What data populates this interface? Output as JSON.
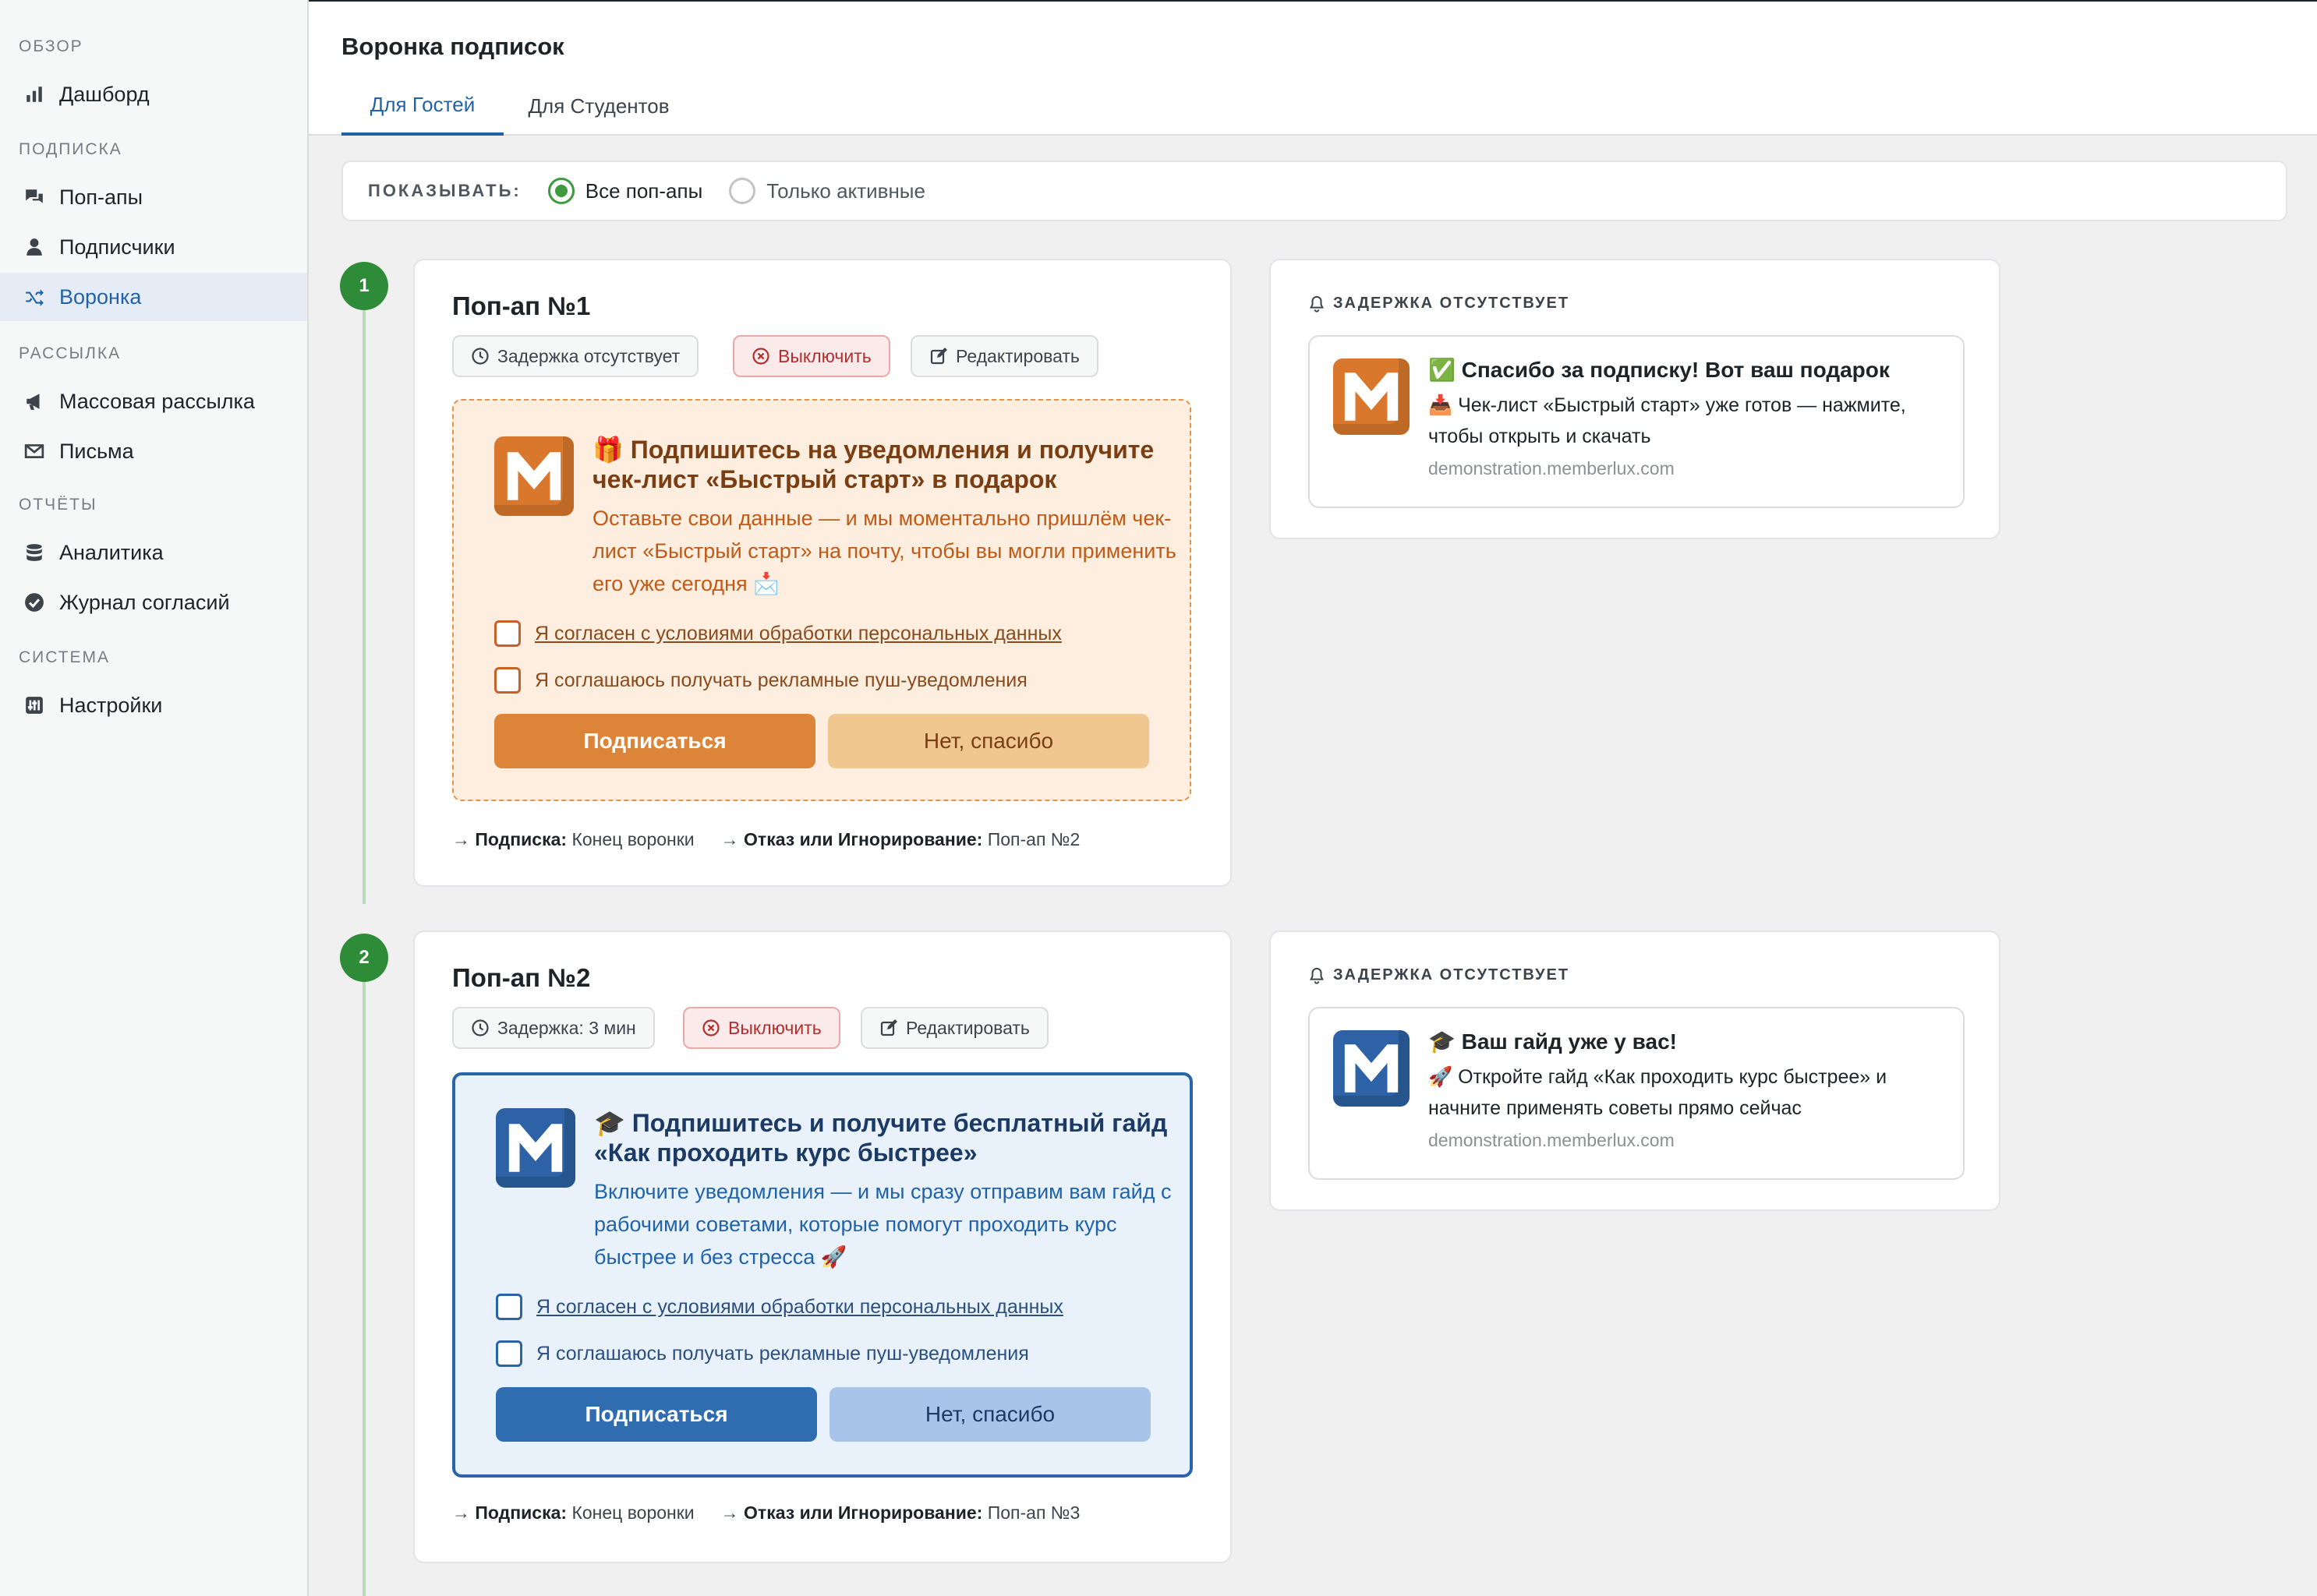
{
  "sidebar": {
    "sections": [
      {
        "label": "ОБЗОР",
        "items": [
          {
            "label": "Дашборд",
            "icon": "bar-chart-icon"
          }
        ]
      },
      {
        "label": "ПОДПИСКА",
        "items": [
          {
            "label": "Поп-апы",
            "icon": "chat-bubbles-icon"
          },
          {
            "label": "Подписчики",
            "icon": "user-icon"
          },
          {
            "label": "Воронка",
            "icon": "shuffle-icon",
            "active": true
          }
        ]
      },
      {
        "label": "РАССЫЛКА",
        "items": [
          {
            "label": "Массовая рассылка",
            "icon": "megaphone-icon"
          },
          {
            "label": "Письма",
            "icon": "envelope-icon"
          }
        ]
      },
      {
        "label": "ОТЧЁТЫ",
        "items": [
          {
            "label": "Аналитика",
            "icon": "database-icon"
          },
          {
            "label": "Журнал согласий",
            "icon": "check-circle-icon"
          }
        ]
      },
      {
        "label": "СИСТЕМА",
        "items": [
          {
            "label": "Настройки",
            "icon": "sliders-icon"
          }
        ]
      }
    ]
  },
  "header": {
    "title": "Воронка подписок",
    "tabs": [
      {
        "label": "Для Гостей",
        "active": true
      },
      {
        "label": "Для Студентов",
        "active": false
      }
    ]
  },
  "filter": {
    "label": "ПОКАЗЫВАТЬ:",
    "options": [
      {
        "label": "Все поп-апы",
        "selected": true
      },
      {
        "label": "Только активные",
        "selected": false
      }
    ]
  },
  "popups": [
    {
      "step": "1",
      "title": "Поп-ап №1",
      "delay_label": "Задержка отсутствует",
      "disable_label": "Выключить",
      "edit_label": "Редактировать",
      "theme": "orange",
      "preview": {
        "title": "🎁 Подпишитесь на уведомления и получите чек-лист «Быстрый старт» в подарок",
        "text": "Оставьте свои данные — и мы моментально пришлём чек-лист «Быстрый старт» на почту, чтобы вы могли применить его уже сегодня 📩",
        "consent1": "Я согласен с условиями обработки персональных данных",
        "consent2": "Я соглашаюсь получать рекламные пуш-уведомления",
        "subscribe": "Подписаться",
        "decline": "Нет, спасибо"
      },
      "route": {
        "sub_label": "Подписка:",
        "sub_value": "Конец воронки",
        "decline_label": "Отказ или Игнорирование:",
        "decline_value": "Поп-ап №2"
      },
      "notification": {
        "header": "ЗАДЕРЖКА ОТСУТСТВУЕТ",
        "title": "✅ Спасибо за подписку! Вот ваш подарок",
        "text": "📥 Чек-лист «Быстрый старт» уже готов — нажмите, чтобы открыть и скачать",
        "site": "demonstration.memberlux.com"
      }
    },
    {
      "step": "2",
      "title": "Поп-ап №2",
      "delay_label": "Задержка: 3 мин",
      "disable_label": "Выключить",
      "edit_label": "Редактировать",
      "theme": "blue",
      "preview": {
        "title": "🎓 Подпишитесь и получите бесплатный гайд «Как проходить курс быстрее»",
        "text": "Включите уведомления — и мы сразу отправим вам гайд с рабочими советами, которые помогут проходить курс быстрее и без стресса 🚀",
        "consent1": "Я согласен с условиями обработки персональных данных",
        "consent2": "Я соглашаюсь получать рекламные пуш-уведомления",
        "subscribe": "Подписаться",
        "decline": "Нет, спасибо"
      },
      "route": {
        "sub_label": "Подписка:",
        "sub_value": "Конец воронки",
        "decline_label": "Отказ или Игнорирование:",
        "decline_value": "Поп-ап №3"
      },
      "notification": {
        "header": "ЗАДЕРЖКА ОТСУТСТВУЕТ",
        "title": "🎓 Ваш гайд уже у вас!",
        "text": "🚀 Откройте гайд «Как проходить курс быстрее» и начните применять советы прямо сейчас",
        "site": "demonstration.memberlux.com"
      }
    }
  ],
  "colors": {
    "accent": "#2163a8",
    "step": "#2e8b38",
    "orange_theme": "#dc8538",
    "blue_theme": "#2f6cb0"
  }
}
